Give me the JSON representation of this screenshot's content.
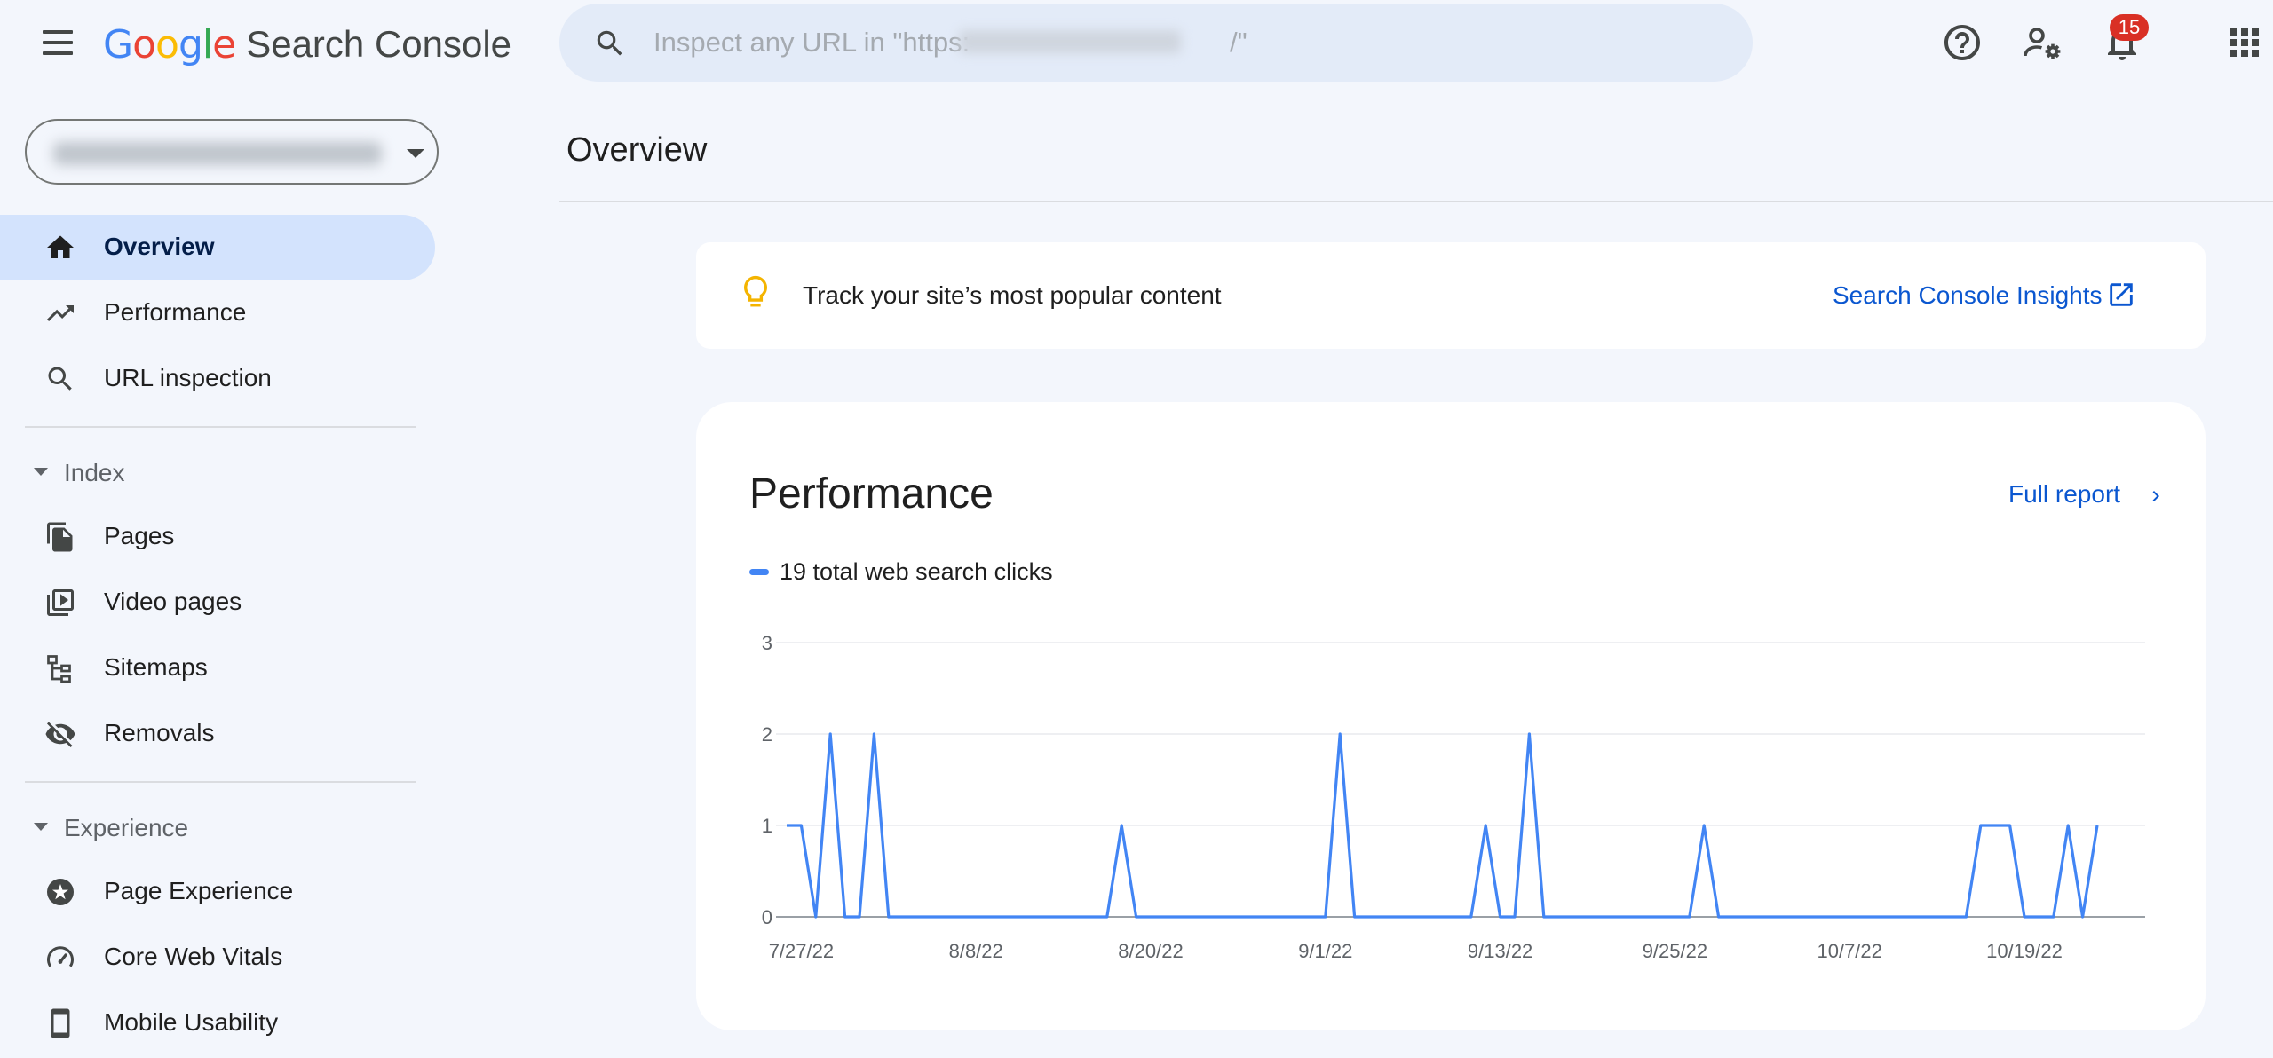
{
  "app": {
    "logo_word": "Google",
    "product_name": "Search Console"
  },
  "search": {
    "placeholder": "Inspect any URL in \"https:                                  /\""
  },
  "notifications": {
    "count": "15"
  },
  "nav": {
    "top_items": [
      {
        "label": "Overview",
        "icon": "home-icon",
        "active": true
      },
      {
        "label": "Performance",
        "icon": "trending-up-icon"
      },
      {
        "label": "URL inspection",
        "icon": "search-icon"
      }
    ],
    "index_section": {
      "label": "Index",
      "items": [
        {
          "label": "Pages",
          "icon": "pages-icon"
        },
        {
          "label": "Video pages",
          "icon": "video-pages-icon"
        },
        {
          "label": "Sitemaps",
          "icon": "sitemap-icon"
        },
        {
          "label": "Removals",
          "icon": "eye-off-icon"
        }
      ]
    },
    "experience_section": {
      "label": "Experience",
      "items": [
        {
          "label": "Page Experience",
          "icon": "page-experience-icon"
        },
        {
          "label": "Core Web Vitals",
          "icon": "gauge-icon"
        },
        {
          "label": "Mobile Usability",
          "icon": "smartphone-icon"
        }
      ]
    }
  },
  "main": {
    "title": "Overview",
    "insight": {
      "text": "Track your site’s most popular content",
      "link": "Search Console Insights"
    },
    "performance": {
      "title": "Performance",
      "full_report": "Full report",
      "legend": "19 total web search clicks"
    }
  },
  "colors": {
    "accent": "#0b57d0",
    "series": "#4285f4",
    "active_nav": "#d3e3fd",
    "badge": "#d93025",
    "bulb": "#f4b400"
  },
  "chart_data": {
    "type": "line",
    "title": "",
    "xlabel": "",
    "ylabel": "",
    "ylim": [
      0,
      3
    ],
    "y_ticks": [
      "0",
      "1",
      "2",
      "3"
    ],
    "x_tick_labels": [
      "7/27/22",
      "8/8/22",
      "8/20/22",
      "9/1/22",
      "9/13/22",
      "9/25/22",
      "10/7/22",
      "10/19/22"
    ],
    "x_start": "7/26/22",
    "grid": true,
    "series": [
      {
        "name": "19 total web search clicks",
        "values": [
          1,
          1,
          0,
          2,
          0,
          0,
          2,
          0,
          0,
          0,
          0,
          0,
          0,
          0,
          0,
          0,
          0,
          0,
          0,
          0,
          0,
          0,
          0,
          1,
          0,
          0,
          0,
          0,
          0,
          0,
          0,
          0,
          0,
          0,
          0,
          0,
          0,
          0,
          2,
          0,
          0,
          0,
          0,
          0,
          0,
          0,
          0,
          0,
          1,
          0,
          0,
          2,
          0,
          0,
          0,
          0,
          0,
          0,
          0,
          0,
          0,
          0,
          0,
          1,
          0,
          0,
          0,
          0,
          0,
          0,
          0,
          0,
          0,
          0,
          0,
          0,
          0,
          0,
          0,
          0,
          0,
          0,
          1,
          1,
          1,
          0,
          0,
          0,
          1,
          0,
          1
        ]
      }
    ]
  }
}
